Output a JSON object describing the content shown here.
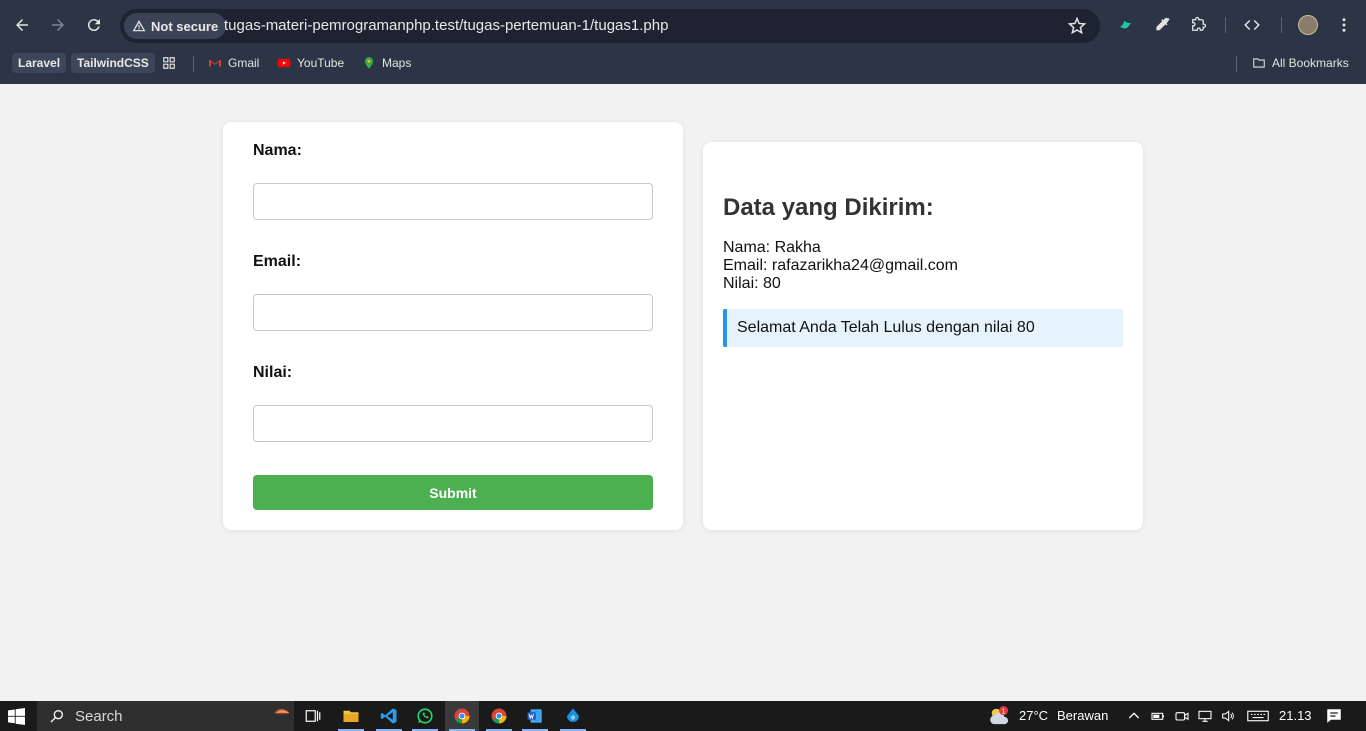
{
  "browser": {
    "security_label": "Not secure",
    "url": "tugas-materi-pemrogramanphp.test/tugas-pertemuan-1/tugas1.php",
    "bookmarks": {
      "chip1": "Laravel",
      "chip2": "TailwindCSS",
      "gmail": "Gmail",
      "youtube": "YouTube",
      "maps": "Maps",
      "all": "All Bookmarks"
    }
  },
  "form": {
    "nama_label": "Nama:",
    "nama_value": "",
    "email_label": "Email:",
    "email_value": "",
    "nilai_label": "Nilai:",
    "nilai_value": "",
    "submit_label": "Submit"
  },
  "result": {
    "title": "Data yang Dikirim:",
    "nama_line": "Nama: Rakha",
    "email_line": "Email: rafazarikha24@gmail.com",
    "nilai_line": "Nilai: 80",
    "message": "Selamat Anda Telah Lulus dengan nilai 80"
  },
  "taskbar": {
    "search_label": "Search",
    "weather_temp": "27°C",
    "weather_desc": "Berawan",
    "weather_badge": "1",
    "time": "21.13"
  },
  "colors": {
    "submit_bg": "#4caf50",
    "alert_border": "#2196f3",
    "alert_bg": "#e6f2fc",
    "chrome_bg": "#2c3545"
  }
}
